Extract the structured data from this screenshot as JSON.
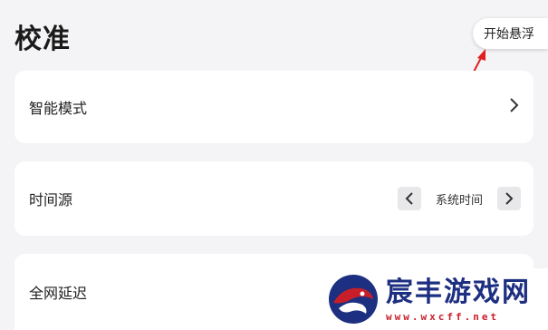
{
  "page": {
    "title": "校准"
  },
  "float_button": {
    "label": "开始悬浮"
  },
  "settings": [
    {
      "label": "智能模式"
    },
    {
      "label": "时间源",
      "value": "系统时间"
    },
    {
      "label": "全网延迟"
    }
  ],
  "watermark": {
    "title": "宸丰游戏网",
    "url": "www.wxcff.net"
  },
  "colors": {
    "annotation_arrow": "#e02020",
    "watermark_title": "#1d2f80",
    "watermark_url": "#c81e2a"
  }
}
